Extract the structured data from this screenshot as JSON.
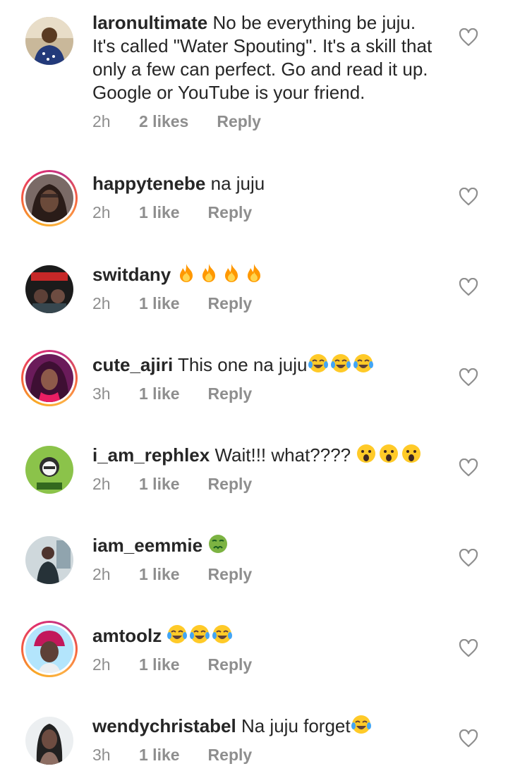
{
  "comments": [
    {
      "username": "laronultimate",
      "text": "No be everything be juju. It's called \"Water Spouting\". It's a skill that only a few can perfect. Go and read it up. Google or YouTube is your friend.",
      "time": "2h",
      "likes": "2 likes",
      "reply": "Reply",
      "avatar_ring": false
    },
    {
      "username": "happytenebe",
      "text": "na juju",
      "time": "2h",
      "likes": "1 like",
      "reply": "Reply",
      "avatar_ring": true
    },
    {
      "username": "switdany",
      "text": "",
      "emojis": [
        "fire-emoji",
        "fire-emoji",
        "fire-emoji",
        "fire-emoji"
      ],
      "time": "2h",
      "likes": "1 like",
      "reply": "Reply",
      "avatar_ring": false
    },
    {
      "username": "cute_ajiri",
      "text": "This one na juju",
      "emojis": [
        "tears-of-joy-emoji",
        "tears-of-joy-emoji",
        "tears-of-joy-emoji"
      ],
      "time": "3h",
      "likes": "1 like",
      "reply": "Reply",
      "avatar_ring": true
    },
    {
      "username": "i_am_rephlex",
      "text": "Wait!!! what????",
      "emojis": [
        "astonished-emoji",
        "astonished-emoji",
        "astonished-emoji"
      ],
      "time": "2h",
      "likes": "1 like",
      "reply": "Reply",
      "avatar_ring": false
    },
    {
      "username": "iam_eemmie",
      "text": "",
      "emojis": [
        "nauseated-emoji"
      ],
      "time": "2h",
      "likes": "1 like",
      "reply": "Reply",
      "avatar_ring": false
    },
    {
      "username": "amtoolz",
      "text": "",
      "emojis": [
        "tears-of-joy-emoji",
        "tears-of-joy-emoji",
        "tears-of-joy-emoji"
      ],
      "time": "2h",
      "likes": "1 like",
      "reply": "Reply",
      "avatar_ring": true
    },
    {
      "username": "wendychristabel",
      "text": "Na juju forget",
      "emojis": [
        "tears-of-joy-emoji"
      ],
      "time": "3h",
      "likes": "1 like",
      "reply": "Reply",
      "avatar_ring": false
    }
  ],
  "colors": {
    "text": "#262626",
    "meta": "#8e8e8e",
    "heart": "#8e8e8e",
    "ring": "#e1306c"
  },
  "icons": {
    "like": "heart-outline-icon"
  }
}
